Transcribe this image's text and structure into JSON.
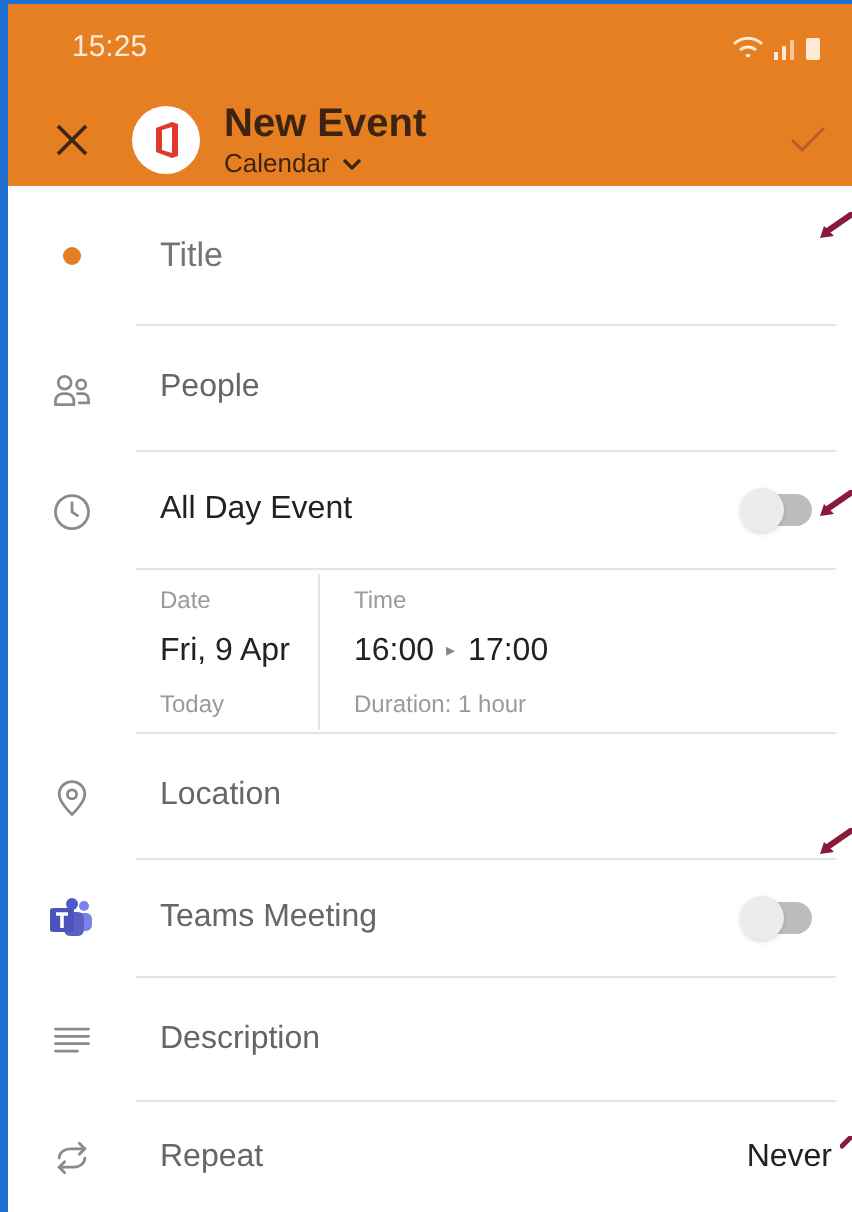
{
  "status_bar": {
    "time": "15:25"
  },
  "header": {
    "title": "New Event",
    "calendar": "Calendar"
  },
  "rows": [
    {
      "kind": "input",
      "placeholder": "Title"
    },
    {
      "kind": "label",
      "label": "People"
    },
    {
      "kind": "toggle",
      "label": "All Day Event",
      "on": false
    },
    {
      "kind": "datetime",
      "date_label": "Date",
      "date": "Fri, 9 Apr",
      "date_note": "Today",
      "time_label": "Time",
      "start": "16:00",
      "arrow": "▸",
      "end": "17:00",
      "duration": "Duration: 1 hour"
    },
    {
      "kind": "label",
      "label": "Location"
    },
    {
      "kind": "toggle",
      "label": "Teams Meeting",
      "on": false
    },
    {
      "kind": "label",
      "label": "Description"
    },
    {
      "kind": "value",
      "label": "Repeat",
      "value": "Never"
    }
  ]
}
